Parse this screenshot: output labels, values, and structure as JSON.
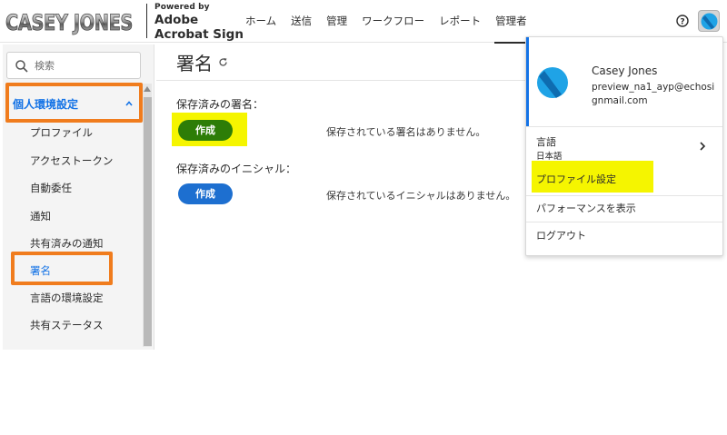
{
  "logo": {
    "text": "CASEY JONES"
  },
  "brand": {
    "powered_by": "Powered by",
    "line1": "Adobe",
    "line2": "Acrobat Sign"
  },
  "nav": [
    {
      "label": "ホーム"
    },
    {
      "label": "送信"
    },
    {
      "label": "管理"
    },
    {
      "label": "ワークフロー"
    },
    {
      "label": "レポート"
    },
    {
      "label": "管理者",
      "active": true
    }
  ],
  "header_icons": [
    "help-icon",
    "avatar-icon"
  ],
  "sidebar": {
    "search_placeholder": "検索",
    "section_label": "個人環境設定",
    "items": [
      {
        "label": "プロファイル"
      },
      {
        "label": "アクセストークン"
      },
      {
        "label": "自動委任"
      },
      {
        "label": "通知"
      },
      {
        "label": "共有済みの通知"
      },
      {
        "label": "署名",
        "selected": true
      },
      {
        "label": "言語の環境設定"
      },
      {
        "label": "共有ステータス"
      }
    ]
  },
  "main": {
    "title": "署名",
    "saved_signature_label": "保存済みの署名：",
    "saved_signature_button": "作成",
    "saved_signature_empty": "保存されている署名はありません。",
    "saved_initials_label": "保存済みのイニシャル：",
    "saved_initials_button": "作成",
    "saved_initials_empty": "保存されているイニシャルはありません。"
  },
  "dropdown": {
    "name": "Casey Jones",
    "email": "preview_na1_ayp@echosignmail.com",
    "language_label": "言語",
    "language_value": "日本語",
    "profile_settings": "プロファイル設定",
    "show_performance": "パフォーマンスを表示",
    "logout": "ログアウト"
  },
  "colors": {
    "accent_blue": "#1473e6",
    "create_green": "#2d7d07",
    "create_blue": "#1d6fd0",
    "highlight_yellow": "#f5f500",
    "annotation_orange": "#f07c1d"
  }
}
